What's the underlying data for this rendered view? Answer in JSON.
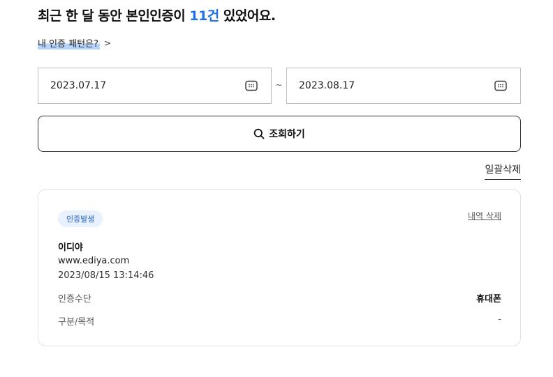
{
  "header": {
    "headline_prefix": "최근 한 달 동안 본인인증이 ",
    "headline_count": "11건",
    "headline_suffix": " 있었어요.",
    "pattern_link": "내 인증 패턴은?",
    "pattern_chevron": ">"
  },
  "filter": {
    "start_date": "2023.07.17",
    "end_date": "2023.08.17",
    "separator": "~",
    "search_label": "조회하기",
    "delete_all_label": "일괄삭제"
  },
  "history": [
    {
      "badge": "인증발생",
      "delete_label": "내역 삭제",
      "site_name": "이디야",
      "site_url": "www.ediya.com",
      "datetime": "2023/08/15 13:14:46",
      "method_label": "인증수단",
      "method_value": "휴대폰",
      "purpose_label": "구분/목적",
      "purpose_value": "-"
    }
  ],
  "colors": {
    "accent": "#1f6fe5",
    "badge_bg": "#e8f1fd",
    "badge_text": "#1f5fbf",
    "highlight": "#b5d4fb"
  },
  "icons": {
    "calendar": "calendar-icon",
    "search": "search-icon",
    "chevron": "chevron-right-icon"
  }
}
